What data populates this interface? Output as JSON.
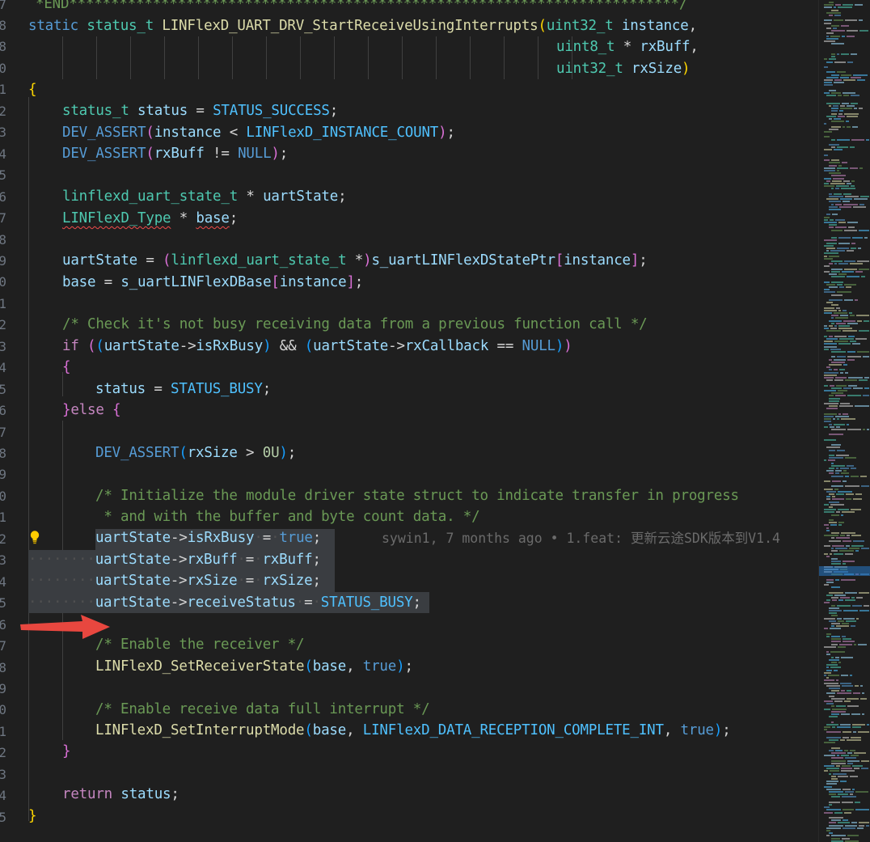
{
  "editor": {
    "line_numbers_visible": [
      "7",
      "8",
      "8",
      "0",
      "1",
      "2",
      "3",
      "4",
      "5",
      "6",
      "7",
      "8",
      "9",
      "0",
      "1",
      "2",
      "3",
      "4",
      "5",
      "6",
      "7",
      "8",
      "9",
      "0",
      "1",
      "2",
      "3",
      "4",
      "5",
      "6",
      "7",
      "8",
      "9",
      "0",
      "1",
      "2",
      "3",
      "4",
      "5"
    ],
    "header_comment": "*END*************************************************************************/",
    "signature_1_ret": "static",
    "signature_1_type": "status_t",
    "function_name": "LINFlexD_UART_DRV_StartReceiveUsingInterrupts",
    "param1_type": "uint32_t",
    "param1_name": "instance",
    "param2_type": "uint8_t",
    "param2_name": "rxBuff",
    "param3_type": "uint32_t",
    "param3_name": "rxSize",
    "status_type": "status_t",
    "status_var": "status",
    "status_success": "STATUS_SUCCESS",
    "dev_assert": "DEV_ASSERT",
    "instance": "instance",
    "instance_count": "LINFlexD_INSTANCE_COUNT",
    "rxbuff": "rxBuff",
    "null": "NULL",
    "state_type": "linflexd_uart_state_t",
    "uart_state": "uartState",
    "base_type": "LINFlexD_Type",
    "base": "base",
    "state_ptr": "s_uartLINFlexDStatePtr",
    "base_arr": "s_uartLINFlexDBase",
    "comment_busy": "/* Check it's not busy receiving data from a previous function call */",
    "kw_if": "if",
    "is_rx_busy": "isRxBusy",
    "rx_callback": "rxCallback",
    "status_busy": "STATUS_BUSY",
    "kw_else": "else",
    "rxsize": "rxSize",
    "zero_u": "0U",
    "comment_init_1": "/* Initialize the module driver state struct to indicate transfer in progress",
    "comment_init_2": " * and with the buffer and byte count data. */",
    "kw_true": "true",
    "receive_status": "receiveStatus",
    "comment_enable_rx": "/* Enable the receiver */",
    "set_receiver_state": "LINFlexD_SetReceiverState",
    "comment_enable_int": "/* Enable receive data full interrupt */",
    "set_interrupt_mode": "LINFlexD_SetInterruptMode",
    "rx_complete_int": "LINFlexD_DATA_RECEPTION_COMPLETE_INT",
    "kw_return": "return",
    "blame": "sywin1, 7 months ago • 1.feat: 更新云途SDK版本到V1.4"
  },
  "colors": {
    "background": "#1f1f1f",
    "keyword": "#569cd6",
    "type": "#4ec9b0",
    "variable": "#9cdcfe",
    "function": "#dcdcaa",
    "comment": "#6a9955",
    "constant": "#4fc1ff",
    "arrow": "#e8473f"
  },
  "icons": {
    "bulb": "lightbulb-icon",
    "arrow": "red-arrow-annotation"
  }
}
